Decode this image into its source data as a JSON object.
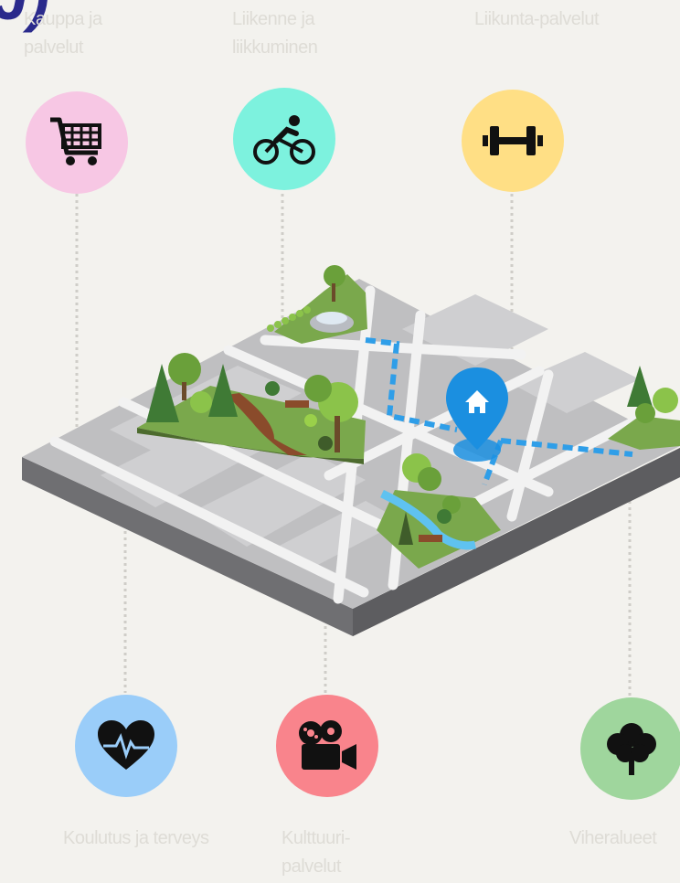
{
  "corner_glyph": "J)",
  "categories": [
    {
      "id": "shop",
      "label": "Kauppa ja palvelut",
      "icon": "shopping-cart-icon",
      "color": "#f7c7e4"
    },
    {
      "id": "traffic",
      "label": "Liikenne ja liikkuminen",
      "icon": "bicycle-icon",
      "color": "#7df2de"
    },
    {
      "id": "sports",
      "label": "Liikunta-palvelut",
      "icon": "dumbbell-icon",
      "color": "#ffdf85"
    },
    {
      "id": "health",
      "label": "Koulutus ja terveys",
      "icon": "heart-pulse-icon",
      "color": "#9acdf9"
    },
    {
      "id": "culture",
      "label": "Kulttuuri-palvelut",
      "icon": "film-camera-icon",
      "color": "#f9848c"
    },
    {
      "id": "green",
      "label": "Viheralueet",
      "icon": "tree-icon",
      "color": "#9fd69d"
    }
  ],
  "colors": {
    "background": "#f3f2ee",
    "label": "#dedcd6",
    "route": "#2f9ee8",
    "pin": "#1b8fe0",
    "grass": "#7aa84c"
  }
}
